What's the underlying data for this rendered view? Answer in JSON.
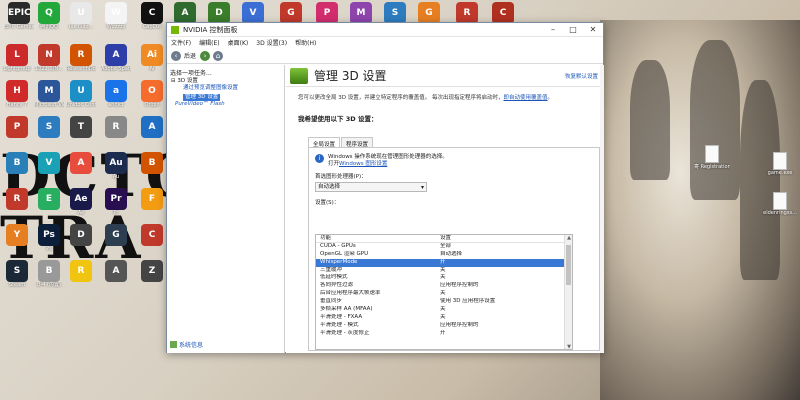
{
  "desktop": {
    "bg_text_lines": [
      "DCTO",
      "TRA"
    ],
    "icons": [
      {
        "label": "EPIC Games Launcher",
        "glyph": "EPIC",
        "color": "#2a2a2a"
      },
      {
        "label": "腾讯QQ",
        "glyph": "Q",
        "color": "#22a83a"
      },
      {
        "label": "uu_fluip...",
        "glyph": "U",
        "color": "#e8e8e8"
      },
      {
        "label": "Wuzzzz",
        "glyph": "W",
        "color": "#f4f4f4"
      },
      {
        "label": "CapCut",
        "glyph": "C",
        "color": "#111111"
      },
      {
        "label": "",
        "glyph": "A",
        "color": "#2f6b2f"
      },
      {
        "label": "",
        "glyph": "D",
        "color": "#3a7d2a"
      },
      {
        "label": "",
        "glyph": "V",
        "color": "#3b6fd6"
      },
      {
        "label": "",
        "glyph": "G",
        "color": "#c0392b"
      },
      {
        "label": "",
        "glyph": "P",
        "color": "#d22d6d"
      },
      {
        "label": "",
        "glyph": "M",
        "color": "#8e44ad"
      },
      {
        "label": "",
        "glyph": "S",
        "color": "#2c7cbf"
      },
      {
        "label": "",
        "glyph": "G",
        "color": "#e67e22"
      },
      {
        "label": "",
        "glyph": "R",
        "color": "#c0392b"
      },
      {
        "label": "",
        "glyph": "C",
        "color": "#b03020"
      },
      {
        "label": "Lightgroup",
        "glyph": "L",
        "color": "#cc2a2a"
      },
      {
        "label": "1022.1(N...",
        "glyph": "N",
        "color": "#c0392b"
      },
      {
        "label": "ResearchDo...",
        "glyph": "R",
        "color": "#d35400"
      },
      {
        "label": "Adobe Spark",
        "glyph": "A",
        "color": "#2d3ea8"
      },
      {
        "label": "Ai",
        "glyph": "Ai",
        "color": "#f08a24"
      },
      {
        "label": "Hancy 7",
        "glyph": "H",
        "color": "#d02a2a"
      },
      {
        "label": "Microsoft Video Editor",
        "glyph": "M",
        "color": "#2b579a"
      },
      {
        "label": "Unidoc Connect",
        "glyph": "U",
        "color": "#1d8fc7"
      },
      {
        "label": "ahdict",
        "glyph": "a",
        "color": "#1a73e8"
      },
      {
        "label": "Origin",
        "glyph": "O",
        "color": "#f56c2d"
      },
      {
        "label": "",
        "glyph": "P",
        "color": "#c0392b"
      },
      {
        "label": "",
        "glyph": "S",
        "color": "#2c7cbf"
      },
      {
        "label": "",
        "glyph": "T",
        "color": "#444444"
      },
      {
        "label": "",
        "glyph": "R",
        "color": "#888888"
      },
      {
        "label": "",
        "glyph": "A",
        "color": "#1f6fc4"
      },
      {
        "label": "",
        "glyph": "B",
        "color": "#2980b9"
      },
      {
        "label": "",
        "glyph": "V",
        "color": "#1aa1b5"
      },
      {
        "label": "",
        "glyph": "A",
        "color": "#e74c3c"
      },
      {
        "label": "Au",
        "glyph": "Au",
        "color": "#1d2b4f"
      },
      {
        "label": "",
        "glyph": "B",
        "color": "#d35400"
      },
      {
        "label": "",
        "glyph": "R",
        "color": "#c0392b"
      },
      {
        "label": "",
        "glyph": "E",
        "color": "#27ae60"
      },
      {
        "label": "Ae",
        "glyph": "Ae",
        "color": "#1a1a4a"
      },
      {
        "label": "Pr",
        "glyph": "Pr",
        "color": "#2a0f50"
      },
      {
        "label": "",
        "glyph": "F",
        "color": "#f39c12"
      },
      {
        "label": "",
        "glyph": "Y",
        "color": "#e67e22"
      },
      {
        "label": "Ps",
        "glyph": "Ps",
        "color": "#0b1f3a"
      },
      {
        "label": "",
        "glyph": "D",
        "color": "#444444"
      },
      {
        "label": "",
        "glyph": "G",
        "color": "#2c3e50"
      },
      {
        "label": "",
        "glyph": "C",
        "color": "#c0392b"
      },
      {
        "label": "Steam",
        "glyph": "S",
        "color": "#1b2838"
      },
      {
        "label": "B-4 (内置)",
        "glyph": "B",
        "color": "#999999"
      },
      {
        "label": "",
        "glyph": "R",
        "color": "#f1c40f"
      },
      {
        "label": "",
        "glyph": "A",
        "color": "#555555"
      },
      {
        "label": "",
        "glyph": "Z",
        "color": "#444444"
      }
    ],
    "right_icons": [
      {
        "label": "寄 Registration ..."
      },
      {
        "label": "game.exe"
      },
      {
        "label": "eldenringss..."
      }
    ]
  },
  "window": {
    "title": "NVIDIA 控制面板",
    "menu": [
      "文件(F)",
      "编辑(E)",
      "桌面(K)",
      "3D 设置(3)",
      "帮助(H)"
    ],
    "toolbar": {
      "back_label": "后退"
    },
    "left_pane": {
      "header": "选择一项任务...",
      "tree": [
        {
          "label": "3D 设置",
          "type": "root"
        },
        {
          "label": "通过预览调整图像设置",
          "type": "child"
        },
        {
          "label": "管理 3D 设置",
          "type": "selected"
        },
        {
          "label": "PureVideo™ Flash",
          "type": "vid"
        }
      ],
      "system_info": "系统信息"
    },
    "right_pane": {
      "title": "管理 3D 设置",
      "restore_defaults": "恢复默认设置",
      "description_pre": "您可以更改全局 3D 设置，并建立特定程序的覆盖值。 每次出现指定程序将启动时，",
      "description_link": "即自动使用覆盖值",
      "description_post": "。",
      "prompt": "我希望使用以下 3D 设置：",
      "tabs": [
        "全局设置",
        "程序设置"
      ],
      "info_text": "Windows 操作系统现在管理图形处理器的选择。",
      "info_link_pre": "打开",
      "info_link": "Windows 图形设置",
      "gpu_label": "首选图形处理器(P)：",
      "gpu_value": "自动选择",
      "settings_label": "设置(S)：",
      "columns": [
        "功能",
        "设置"
      ],
      "rows": [
        {
          "feature": "CUDA - GPUs",
          "setting": "全部"
        },
        {
          "feature": "OpenGL 渲染 GPU",
          "setting": "自动选择"
        },
        {
          "feature": "WhisperMode",
          "setting": "开",
          "selected": true
        },
        {
          "feature": "三重缓冲",
          "setting": "关"
        },
        {
          "feature": "低延时模式",
          "setting": "关"
        },
        {
          "feature": "各向异性过滤",
          "setting": "应用程序控制的"
        },
        {
          "feature": "后台应用程序最大帧速率",
          "setting": "关"
        },
        {
          "feature": "垂直同步",
          "setting": "使用 3D 应用程序设置"
        },
        {
          "feature": "多帧采样 AA (MFAA)",
          "setting": "关"
        },
        {
          "feature": "平滑处理 - FXAA",
          "setting": "关"
        },
        {
          "feature": "平滑处理 - 模式",
          "setting": "应用程序控制的"
        },
        {
          "feature": "平滑处理 - 灰度修正",
          "setting": "开"
        }
      ]
    }
  }
}
